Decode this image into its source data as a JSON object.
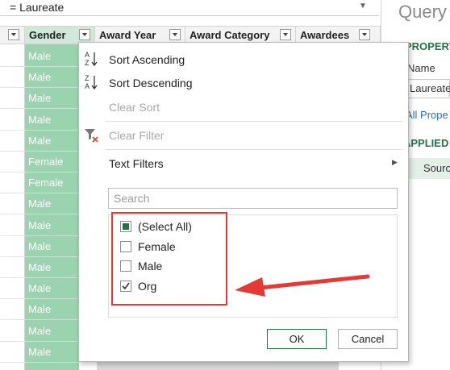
{
  "formula_bar": {
    "text": "= Laureate"
  },
  "columns": [
    "Gender",
    "Award Year",
    "Award Category",
    "Awardees"
  ],
  "gender_rows": [
    "Male",
    "Male",
    "Male",
    "Male",
    "Male",
    "Female",
    "Female",
    "Male",
    "Male",
    "Male",
    "Male",
    "Male",
    "Male",
    "Male",
    "Male"
  ],
  "right_pane": {
    "title": "Query",
    "properties_heading": "PROPERT",
    "name_label": "Name",
    "name_value": "Laureate",
    "all_properties_link": "All Prope",
    "applied_heading": "APPLIED",
    "step_source": "Sourc"
  },
  "menu": {
    "sort_ascending": "Sort Ascending",
    "sort_descending": "Sort Descending",
    "clear_sort": "Clear Sort",
    "clear_filter": "Clear Filter",
    "text_filters": "Text Filters",
    "search_placeholder": "Search",
    "items": [
      {
        "label": "(Select All)",
        "state": "partial"
      },
      {
        "label": "Female",
        "state": "unchecked"
      },
      {
        "label": "Male",
        "state": "unchecked"
      },
      {
        "label": "Org",
        "state": "checked"
      }
    ],
    "ok_label": "OK",
    "cancel_label": "Cancel"
  },
  "colors": {
    "accent": "#217346",
    "gender_column": "#9bd3b0",
    "annotation": "#e53935"
  },
  "icons": [
    "sort-ascending-icon",
    "sort-descending-icon",
    "clear-filter-icon",
    "submenu-arrow-icon",
    "filter-dropdown-icon",
    "annotation-arrow-icon"
  ]
}
